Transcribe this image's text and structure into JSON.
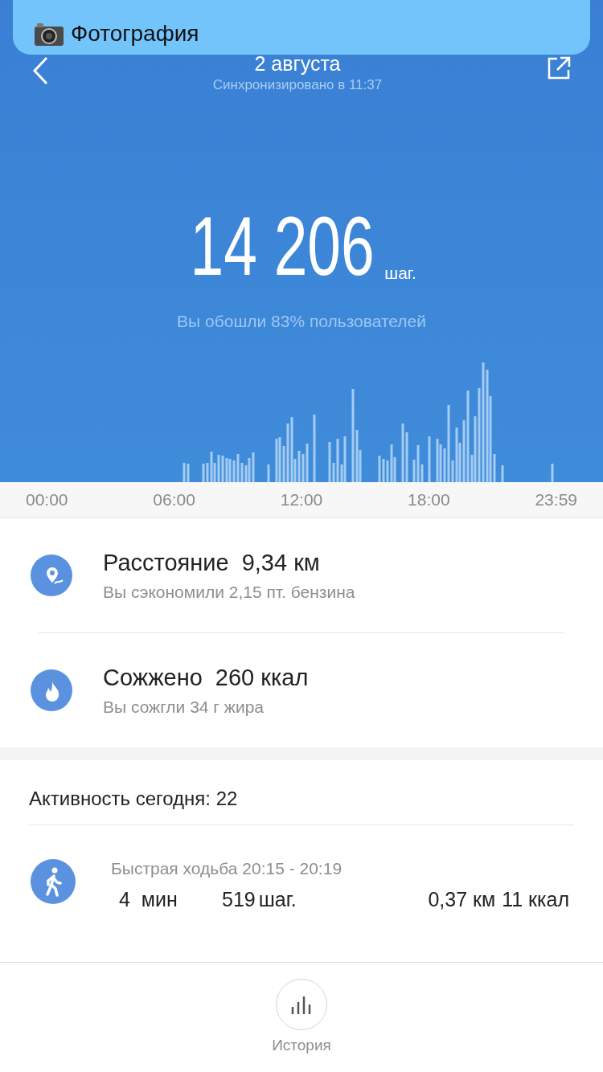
{
  "notification": {
    "title": "Фотография"
  },
  "header": {
    "date": "2 августа",
    "sync": "Синхронизировано в 11:37"
  },
  "steps": {
    "value": "14 206",
    "unit": "шаг.",
    "note": "Вы обошли 83% пользователей"
  },
  "time_axis": [
    "00:00",
    "06:00",
    "12:00",
    "18:00",
    "23:59"
  ],
  "stats": [
    {
      "kind": "distance",
      "title": "Расстояние",
      "value": "9,34 км",
      "note": "Вы сэкономили 2,15 пт. бензина"
    },
    {
      "kind": "calories",
      "title": "Сожжено",
      "value": "260 ккал",
      "note": "Вы сожгли 34 г жира"
    }
  ],
  "activity": {
    "title": "Активность сегодня: 22",
    "items": [
      {
        "kind": "walk",
        "name": "Быстрая ходьба 20:15 - 20:19",
        "duration": "4  мин",
        "steps": "519",
        "steps_unit": "шаг.",
        "distance": "0,37 км",
        "calories": "11 ккал"
      }
    ]
  },
  "nav": {
    "label": "История"
  }
}
